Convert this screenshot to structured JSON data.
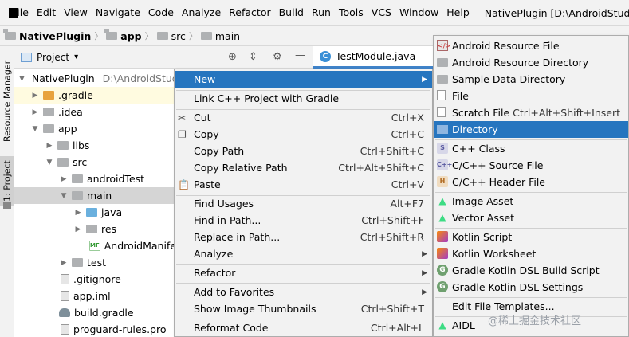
{
  "menubar": {
    "items": [
      "File",
      "Edit",
      "View",
      "Navigate",
      "Code",
      "Analyze",
      "Refactor",
      "Build",
      "Run",
      "Tools",
      "VCS",
      "Window",
      "Help"
    ],
    "title": "NativePlugin [D:\\AndroidStudio"
  },
  "breadcrumb": {
    "items": [
      "NativePlugin",
      "app",
      "src",
      "main"
    ]
  },
  "strip": {
    "resource_manager": "Resource Manager",
    "project_tab": "1: Project"
  },
  "project_panel": {
    "title": "Project",
    "dropdown": "▾"
  },
  "editor": {
    "tab_label": "TestModule.java",
    "tab_icon": "C"
  },
  "tree": {
    "root_label": "NativePlugin",
    "root_path": "D:\\AndroidStudi",
    "rows": [
      {
        "label": ".gradle"
      },
      {
        "label": ".idea"
      },
      {
        "label": "app"
      },
      {
        "label": "libs"
      },
      {
        "label": "src"
      },
      {
        "label": "androidTest"
      },
      {
        "label": "main"
      },
      {
        "label": "java"
      },
      {
        "label": "res"
      },
      {
        "label": "AndroidManifest"
      },
      {
        "label": "test"
      },
      {
        "label": ".gitignore"
      },
      {
        "label": "app.iml"
      },
      {
        "label": "build.gradle"
      },
      {
        "label": "proguard-rules.pro"
      }
    ]
  },
  "context_menu": {
    "items": [
      {
        "label": "New",
        "shortcut": ""
      },
      {
        "label": "Link C++ Project with Gradle",
        "shortcut": ""
      },
      {
        "label": "Cut",
        "shortcut": "Ctrl+X"
      },
      {
        "label": "Copy",
        "shortcut": "Ctrl+C"
      },
      {
        "label": "Copy Path",
        "shortcut": "Ctrl+Shift+C"
      },
      {
        "label": "Copy Relative Path",
        "shortcut": "Ctrl+Alt+Shift+C"
      },
      {
        "label": "Paste",
        "shortcut": "Ctrl+V"
      },
      {
        "label": "Find Usages",
        "shortcut": "Alt+F7"
      },
      {
        "label": "Find in Path...",
        "shortcut": "Ctrl+Shift+F"
      },
      {
        "label": "Replace in Path...",
        "shortcut": "Ctrl+Shift+R"
      },
      {
        "label": "Analyze",
        "shortcut": ""
      },
      {
        "label": "Refactor",
        "shortcut": ""
      },
      {
        "label": "Add to Favorites",
        "shortcut": ""
      },
      {
        "label": "Show Image Thumbnails",
        "shortcut": "Ctrl+Shift+T"
      },
      {
        "label": "Reformat Code",
        "shortcut": "Ctrl+Alt+L"
      }
    ]
  },
  "submenu": {
    "items": [
      {
        "label": "Android Resource File",
        "shortcut": ""
      },
      {
        "label": "Android Resource Directory",
        "shortcut": ""
      },
      {
        "label": "Sample Data Directory",
        "shortcut": ""
      },
      {
        "label": "File",
        "shortcut": ""
      },
      {
        "label": "Scratch File",
        "shortcut": "Ctrl+Alt+Shift+Insert"
      },
      {
        "label": "Directory",
        "shortcut": ""
      },
      {
        "label": "C++ Class",
        "shortcut": ""
      },
      {
        "label": "C/C++ Source File",
        "shortcut": ""
      },
      {
        "label": "C/C++ Header File",
        "shortcut": ""
      },
      {
        "label": "Image Asset",
        "shortcut": ""
      },
      {
        "label": "Vector Asset",
        "shortcut": ""
      },
      {
        "label": "Kotlin Script",
        "shortcut": ""
      },
      {
        "label": "Kotlin Worksheet",
        "shortcut": ""
      },
      {
        "label": "Gradle Kotlin DSL Build Script",
        "shortcut": ""
      },
      {
        "label": "Gradle Kotlin DSL Settings",
        "shortcut": ""
      },
      {
        "label": "Edit File Templates...",
        "shortcut": ""
      },
      {
        "label": "AIDL",
        "shortcut": ""
      }
    ]
  },
  "watermark": "@稀土掘金技术社区",
  "colors": {
    "selection": "#2675bf",
    "tree_selected": "#d5d5d5",
    "highlight_row": "#fffbe0"
  }
}
